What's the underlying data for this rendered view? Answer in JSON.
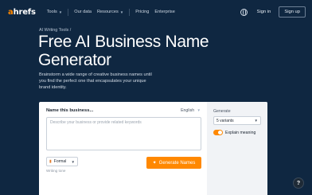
{
  "nav": {
    "logo_a": "a",
    "logo_rest": "hrefs",
    "items": [
      {
        "label": "Tools",
        "has_dropdown": true
      },
      {
        "label": "Our data",
        "has_dropdown": false
      },
      {
        "label": "Resources",
        "has_dropdown": true
      },
      {
        "label": "Pricing",
        "has_dropdown": false
      },
      {
        "label": "Enterprise",
        "has_dropdown": false
      }
    ],
    "globe_icon": "globe-icon",
    "sign_in": "Sign in",
    "sign_up": "Sign up"
  },
  "hero": {
    "breadcrumb": "AI Writing Tools /",
    "title": "Free AI Business Name Generator",
    "description": "Brainstorm a wide range of creative business names until you find the perfect one that encapsulates your unique brand identity."
  },
  "form": {
    "name_label": "Name this business...",
    "language": "English",
    "textarea_placeholder": "Describe your business or provide related keywords",
    "tone_value": "Formal",
    "tone_label": "Writing tone",
    "generate_button": "Generate Names",
    "generate_label": "Generate",
    "variants_value": "5 variants",
    "explain_label": "Explain meaning",
    "explain_enabled": true
  },
  "help_label": "?",
  "colors": {
    "background": "#0f2741",
    "accent": "#ff8800",
    "card": "#ffffff",
    "sidebar": "#f1f3f6"
  }
}
